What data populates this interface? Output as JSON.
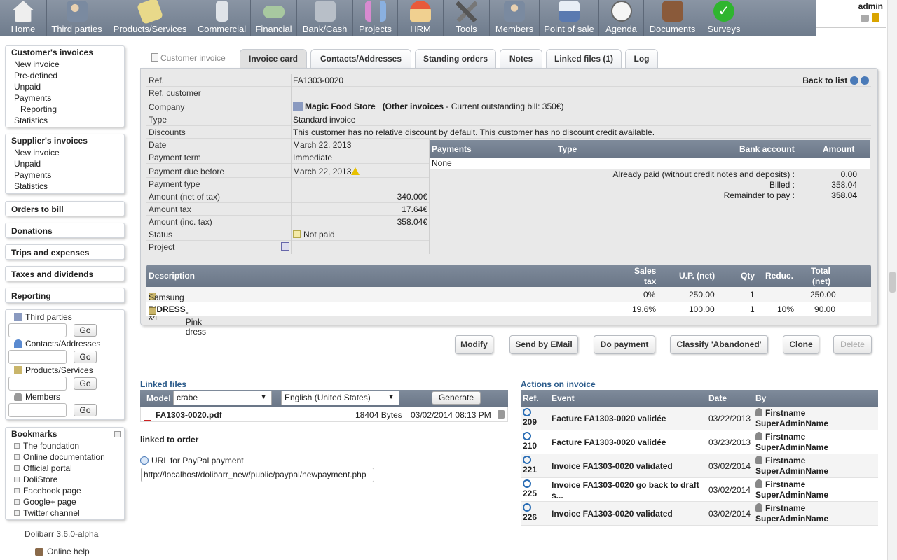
{
  "login": {
    "user": "admin"
  },
  "topmenu": [
    {
      "label": "Home",
      "icon": "home-icon"
    },
    {
      "label": "Third parties",
      "icon": "users-icon"
    },
    {
      "label": "Products/Services",
      "icon": "products-icon"
    },
    {
      "label": "Commercial",
      "icon": "commercial-icon"
    },
    {
      "label": "Financial",
      "icon": "money-icon"
    },
    {
      "label": "Bank/Cash",
      "icon": "bank-icon"
    },
    {
      "label": "Projects",
      "icon": "projects-icon"
    },
    {
      "label": "HRM",
      "icon": "hrm-icon"
    },
    {
      "label": "Tools",
      "icon": "tools-icon"
    },
    {
      "label": "Members",
      "icon": "members-icon"
    },
    {
      "label": "Point of sale",
      "icon": "pos-icon"
    },
    {
      "label": "Agenda",
      "icon": "clock-icon"
    },
    {
      "label": "Documents",
      "icon": "documents-icon"
    },
    {
      "label": "Surveys",
      "icon": "check-icon"
    }
  ],
  "leftmenu": {
    "customer_invoices": {
      "title": "Customer's invoices",
      "items": [
        "New invoice",
        "Pre-defined",
        "Unpaid",
        "Payments"
      ],
      "sub": "Reporting",
      "last": "Statistics"
    },
    "supplier_invoices": {
      "title": "Supplier's invoices",
      "items": [
        "New invoice",
        "Unpaid",
        "Payments",
        "Statistics"
      ]
    },
    "singles": [
      "Orders to bill",
      "Donations",
      "Trips and expenses",
      "Taxes and dividends",
      "Reporting"
    ],
    "search": {
      "labels": [
        "Third parties",
        "Contacts/Addresses",
        "Products/Services",
        "Members"
      ],
      "go": "Go"
    },
    "bookmarks": {
      "title": "Bookmarks",
      "items": [
        "The foundation",
        "Online documentation",
        "Official portal",
        "DoliStore",
        "Facebook page",
        "Google+ page",
        "Twitter channel"
      ]
    },
    "version": "Dolibarr 3.6.0-alpha",
    "help": "Online help"
  },
  "tabs": {
    "head": "Customer invoice",
    "items": [
      "Invoice card",
      "Contacts/Addresses",
      "Standing orders",
      "Notes",
      "Linked files (1)",
      "Log"
    ]
  },
  "card": {
    "ref_label": "Ref.",
    "ref": "FA1303-0020",
    "back": "Back to list",
    "refcust_label": "Ref. customer",
    "company_label": "Company",
    "company": "Magic Food Store",
    "company_other": "(Other invoices",
    "company_bill": " - Current outstanding bill: 350€)",
    "type_label": "Type",
    "type": "Standard invoice",
    "discount_label": "Discounts",
    "discount": "This customer has no relative discount by default. This customer has no discount credit available.",
    "date_label": "Date",
    "date": "March 22, 2013",
    "term_label": "Payment term",
    "term": "Immediate",
    "due_label": "Payment due before",
    "due": "March 22, 2013",
    "ptype_label": "Payment type",
    "net_label": "Amount (net of tax)",
    "net": "340.00€",
    "tax_label": "Amount tax",
    "tax": "17.64€",
    "inc_label": "Amount (inc. tax)",
    "inc": "358.04€",
    "status_label": "Status",
    "status": "Not paid",
    "project_label": "Project"
  },
  "payments": {
    "head": [
      "Payments",
      "Type",
      "Bank account",
      "Amount"
    ],
    "none": "None",
    "paid_label": "Already paid (without credit notes and deposits) :",
    "paid": "0.00",
    "billed_label": "Billed :",
    "billed": "358.04",
    "remain_label": "Remainder to pay :",
    "remain": "358.04"
  },
  "lines": {
    "head": {
      "desc": "Description",
      "tax1": "Sales",
      "tax2": "tax",
      "up": "U.P. (net)",
      "qty": "Qty",
      "reduc": "Reduc.",
      "tot1": "Total",
      "tot2": "(net)"
    },
    "rows": [
      {
        "ref": "",
        "desc": "Samsung Android x4",
        "tax": "0%",
        "up": "250.00",
        "qty": "1",
        "reduc": "",
        "total": "250.00"
      },
      {
        "ref": "PIDRESS",
        "desc": " - Pink dress",
        "tax": "19.6%",
        "up": "100.00",
        "qty": "1",
        "reduc": "10%",
        "total": "90.00"
      }
    ]
  },
  "actions": [
    "Modify",
    "Send by EMail",
    "Do payment",
    "Classify 'Abandoned'",
    "Clone",
    "Delete"
  ],
  "files": {
    "title": "Linked files",
    "model_label": "Model",
    "model": "crabe",
    "lang": "English (United States)",
    "generate": "Generate",
    "file": {
      "name": "FA1303-0020.pdf",
      "size": "18404 Bytes",
      "date": "03/02/2014 08:13 PM"
    },
    "linked_order": "linked to order",
    "paypal_label": "URL for PayPal payment",
    "paypal_url": "http://localhost/dolibarr_new/public/paypal/newpayment.php"
  },
  "events": {
    "title": "Actions on invoice",
    "head": [
      "Ref.",
      "Event",
      "Date",
      "By"
    ],
    "rows": [
      {
        "ref": "209",
        "event": "Facture FA1303-0020 validée",
        "date": "03/22/2013",
        "by1": "Firstname",
        "by2": "SuperAdminName"
      },
      {
        "ref": "210",
        "event": "Facture FA1303-0020 validée",
        "date": "03/23/2013",
        "by1": "Firstname",
        "by2": "SuperAdminName"
      },
      {
        "ref": "221",
        "event": "Invoice FA1303-0020 validated",
        "date": "03/02/2014",
        "by1": "Firstname",
        "by2": "SuperAdminName"
      },
      {
        "ref": "225",
        "event": "Invoice FA1303-0020 go back to draft s...",
        "date": "03/02/2014",
        "by1": "Firstname",
        "by2": "SuperAdminName"
      },
      {
        "ref": "226",
        "event": "Invoice FA1303-0020 validated",
        "date": "03/02/2014",
        "by1": "Firstname",
        "by2": "SuperAdminName"
      }
    ]
  }
}
